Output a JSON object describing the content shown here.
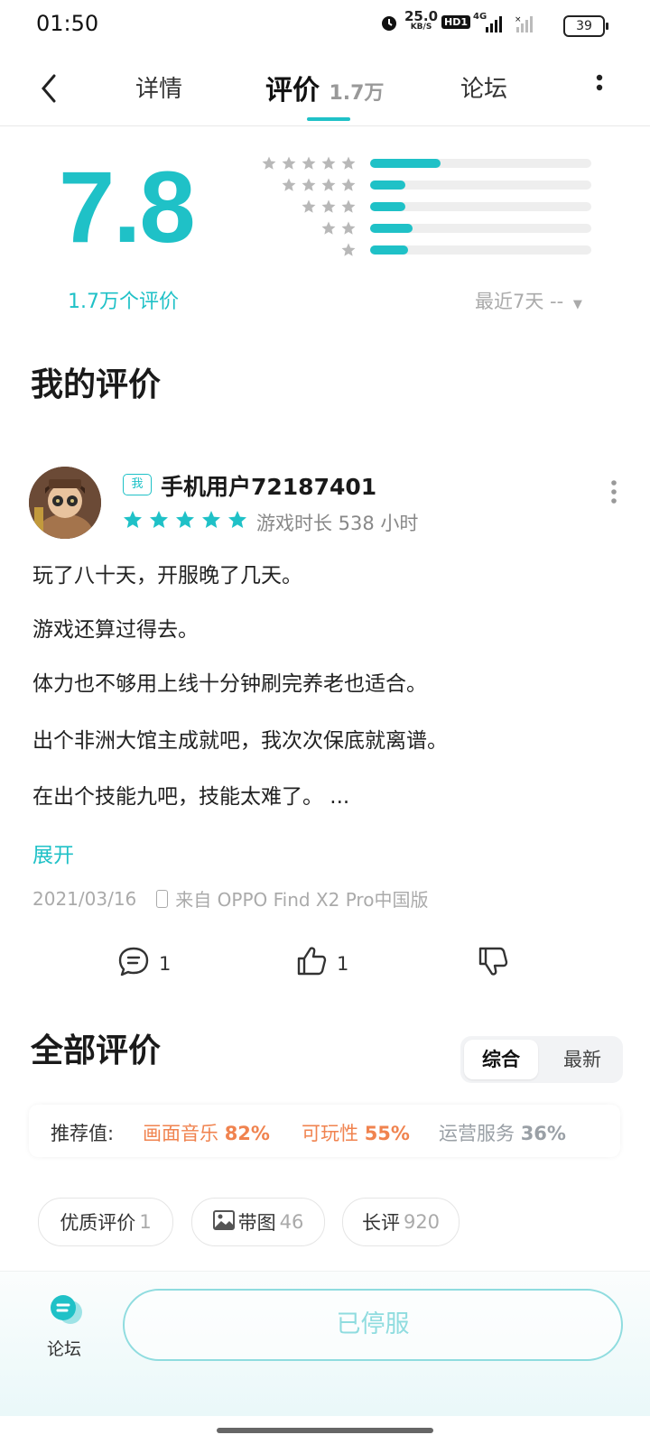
{
  "status_bar": {
    "time": "01:50",
    "net_speed": "25.0",
    "net_unit": "KB/S",
    "hd": "HD1",
    "network": "4G",
    "battery": "39"
  },
  "nav": {
    "tabs": [
      {
        "label": "详情",
        "count": ""
      },
      {
        "label": "评价",
        "count": "1.7万"
      },
      {
        "label": "论坛",
        "count": ""
      }
    ]
  },
  "rating": {
    "score": "7.8",
    "count_label": "1.7万个评价",
    "distribution": [
      {
        "stars": 5,
        "fraction": 0.32
      },
      {
        "stars": 4,
        "fraction": 0.16
      },
      {
        "stars": 3,
        "fraction": 0.16
      },
      {
        "stars": 2,
        "fraction": 0.19
      },
      {
        "stars": 1,
        "fraction": 0.17
      }
    ],
    "period": "最近7天 --"
  },
  "my_review": {
    "section_title": "我的评价",
    "badge": "我",
    "username": "手机用户72187401",
    "stars": 5,
    "playtime": "游戏时长 538 小时",
    "lines": [
      "玩了八十天，开服晚了几天。",
      "游戏还算过得去。",
      "体力也不够用上线十分钟刷完养老也适合。",
      "出个非洲大馆主成就吧，我次次保底就离谱。",
      "在出个技能九吧，技能太难了。 ..."
    ],
    "expand": "展开",
    "date": "2021/03/16",
    "device": "来自 OPPO Find X2 Pro中国版",
    "comments": "1",
    "likes": "1"
  },
  "all_reviews": {
    "section_title": "全部评价",
    "sort_options": [
      "综合",
      "最新"
    ],
    "recommend": {
      "label": "推荐值:",
      "items": [
        {
          "name": "画面音乐",
          "value": "82%",
          "color": "#f0834f"
        },
        {
          "name": "可玩性",
          "value": "55%",
          "color": "#f0834f"
        },
        {
          "name": "运营服务",
          "value": "36%",
          "color": "#9aa0a6"
        }
      ]
    },
    "chips": [
      {
        "label": "优质评价",
        "count": "1"
      },
      {
        "label": "带图",
        "count": "46"
      },
      {
        "label": "长评",
        "count": "920"
      }
    ]
  },
  "bottom": {
    "forum_label": "论坛",
    "button_label": "已停服"
  },
  "colors": {
    "accent": "#1fc1c7",
    "star_gray": "#b8b8b8",
    "bar_track": "#eeeeee"
  }
}
